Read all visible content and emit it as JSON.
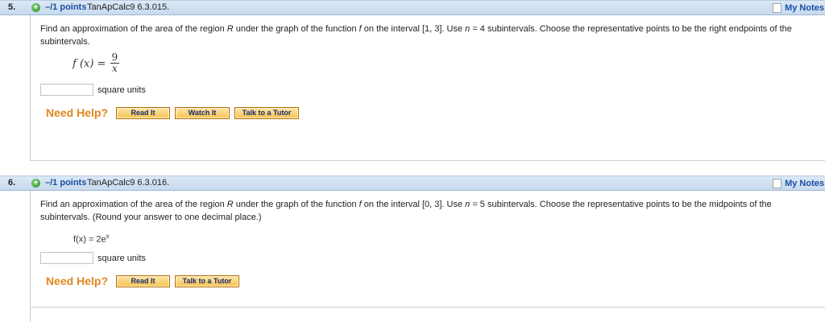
{
  "questions": [
    {
      "number": "5.",
      "points": "–/1 points",
      "id": "TanApCalc9 6.3.015.",
      "my_notes": "My Notes",
      "prompt_line1_a": "Find an approximation of the area of the region ",
      "prompt_R": "R",
      "prompt_line1_b": " under the graph of the function ",
      "prompt_f": "f",
      "prompt_line1_c": " on the interval [1, 3]. Use ",
      "prompt_n": "n",
      "prompt_line1_d": " = 4 subintervals. Choose the representative points to be the right endpoints of the subintervals.",
      "formula": {
        "lhs": "f (x) =",
        "numerator": "9",
        "denominator": "x"
      },
      "units": "square units",
      "need_help": "Need Help?",
      "buttons": [
        "Read It",
        "Watch It",
        "Talk to a Tutor"
      ]
    },
    {
      "number": "6.",
      "points": "–/1 points",
      "id": "TanApCalc9 6.3.016.",
      "my_notes": "My Notes",
      "prompt_line1_a": "Find an approximation of the area of the region ",
      "prompt_R": "R",
      "prompt_line1_b": " under the graph of the function ",
      "prompt_f": "f",
      "prompt_line1_c": " on the interval [0, 3]. Use ",
      "prompt_n": "n",
      "prompt_line1_d": " = 5 subintervals. Choose the representative points to be the midpoints of the subintervals. (Round your answer to one decimal place.)",
      "formula": {
        "text": "f(x) = 2e",
        "sup": "x"
      },
      "units": "square units",
      "need_help": "Need Help?",
      "buttons": [
        "Read It",
        "Talk to a Tutor"
      ]
    }
  ]
}
